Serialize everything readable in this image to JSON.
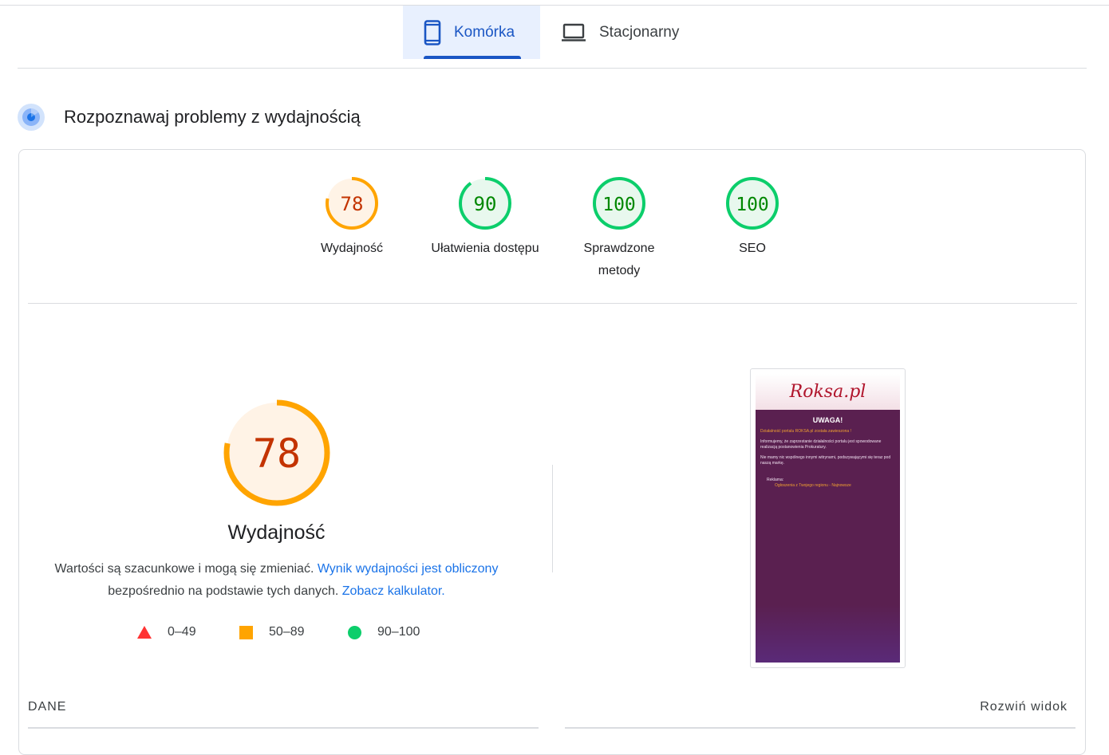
{
  "tabs": [
    {
      "label": "Komórka",
      "active": true,
      "icon": "smartphone-icon"
    },
    {
      "label": "Stacjonarny",
      "active": false,
      "icon": "laptop-icon"
    }
  ],
  "section": {
    "title": "Rozpoznawaj problemy z wydajnością",
    "icon": "performance-diagnose-icon"
  },
  "scores": [
    {
      "value": "78",
      "label": "Wydajność",
      "level": 78,
      "color": "#ffa400",
      "text_color": "#c33300",
      "bg": "#fff3e6"
    },
    {
      "value": "90",
      "label": "Ułatwienia dostępu",
      "level": 90,
      "color": "#0cce6b",
      "text_color": "#008800",
      "bg": "#e8f8ee"
    },
    {
      "value": "100",
      "label": "Sprawdzone metody",
      "level": 100,
      "color": "#0cce6b",
      "text_color": "#008800",
      "bg": "#e8f8ee"
    },
    {
      "value": "100",
      "label": "SEO",
      "level": 100,
      "color": "#0cce6b",
      "text_color": "#008800",
      "bg": "#e8f8ee"
    }
  ],
  "main": {
    "score": "78",
    "level": 78,
    "title": "Wydajność",
    "desc_text1": "Wartości są szacunkowe i mogą się zmieniać. ",
    "desc_link1": "Wynik wydajności jest obliczony",
    "desc_text2": " bezpośrednio na podstawie tych danych. ",
    "desc_link2": "Zobacz kalkulator."
  },
  "legend": [
    {
      "range": "0–49",
      "shape": "triangle",
      "color": "#ff3333"
    },
    {
      "range": "50–89",
      "shape": "square",
      "color": "#ffa400"
    },
    {
      "range": "90–100",
      "shape": "circle",
      "color": "#0cce6b"
    }
  ],
  "screenshot": {
    "logo": "Roksa.pl",
    "warning": "UWAGA!",
    "line1": "Działalność portalu ROKSA.pl została zawieszona !",
    "line2": "Informujemy, że zaprzestanie działalności portalu jest spowodowane realizacją postanowienia Prokuratury.",
    "line3": "Nie mamy nic wspólnego innymi witrynami, podszywającymi się teraz pod naszą markę.",
    "ad_label": "Reklama:",
    "ad_link": "Ogłoszenia z Twojego regionu - Najnowsze"
  },
  "footer": {
    "left": "DANE",
    "right": "Rozwiń widok"
  }
}
